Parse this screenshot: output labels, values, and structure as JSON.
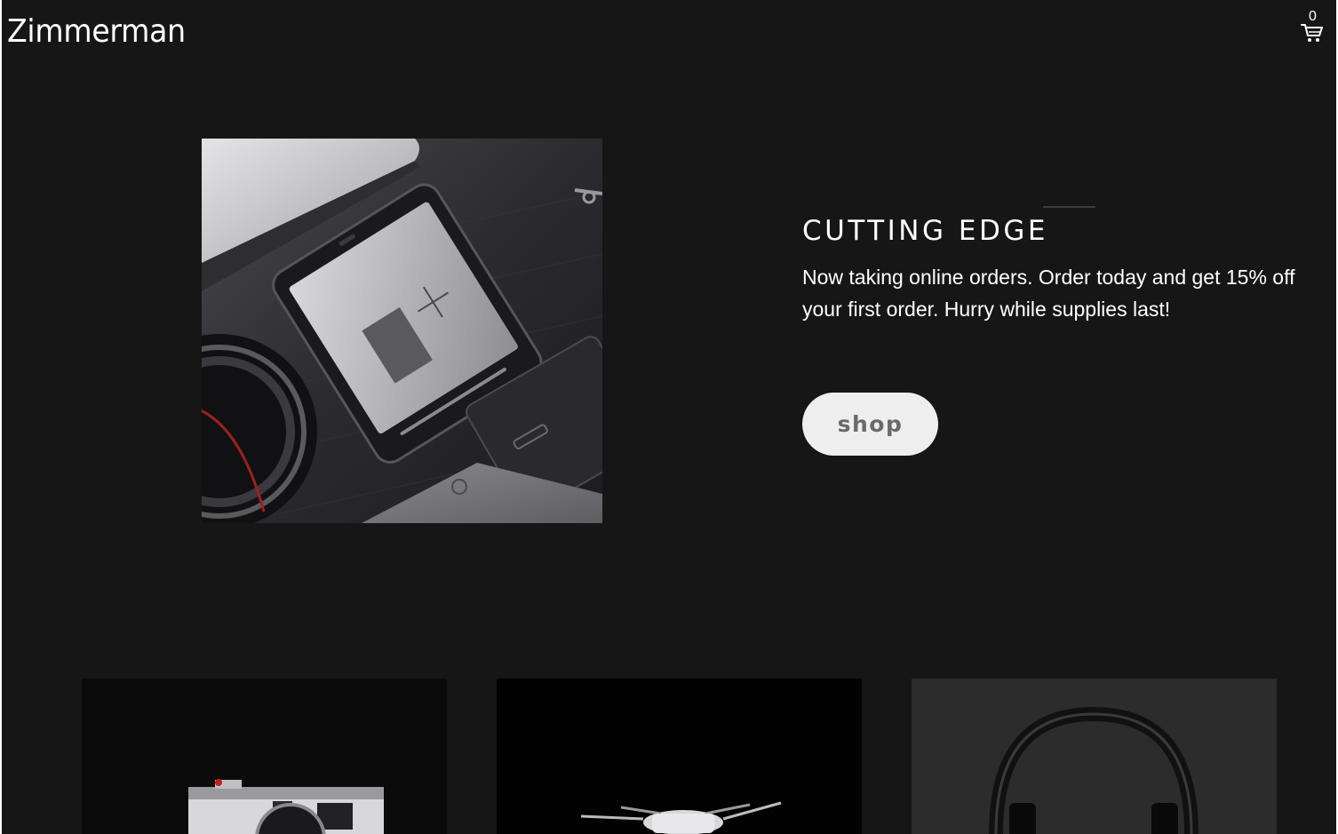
{
  "header": {
    "brand": "Zimmerman",
    "cart_count": "0",
    "cart_icon": "cart-icon"
  },
  "hero": {
    "heading": "CUTTING EDGE",
    "text": "Now taking online orders. Order today and get 15% off your first order. Hurry while supplies last!",
    "button_label": "shop",
    "image": "phone-and-gadgets-photo"
  },
  "products": [
    {
      "image": "camera-photo"
    },
    {
      "image": "drone-photo"
    },
    {
      "image": "headphones-photo"
    }
  ],
  "colors": {
    "background": "#161616",
    "text": "#ffffff",
    "button_bg": "#eeeeee",
    "button_text": "#6a6a6a"
  }
}
